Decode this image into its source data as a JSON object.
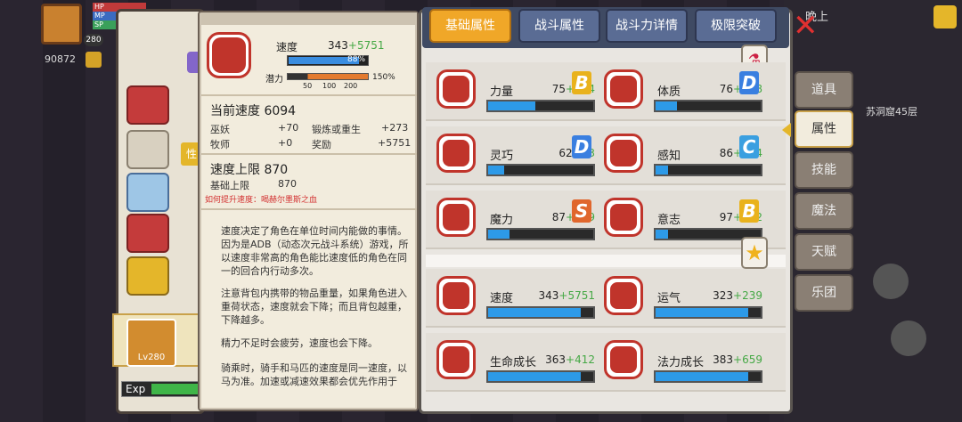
{
  "hud": {
    "level": "280",
    "hp_label": "HP",
    "mp_label": "MP",
    "sp_label": "SP",
    "gold": "90872",
    "night_label": "晚上",
    "dungeon_label": "苏洞窟45层",
    "exp_label": "Exp",
    "char_level": "Lv280"
  },
  "equip_tab_label": "性",
  "tooltip": {
    "speed_label": "速度",
    "speed_base": "343",
    "speed_bonus": "+5751",
    "bar_percent": "88%",
    "potential_label": "潜力",
    "potential_scale": [
      "50",
      "100",
      "200"
    ],
    "potential_percent": "150%",
    "current_speed_label": "当前速度",
    "current_speed_value": "6094",
    "sources": [
      {
        "name": "巫妖",
        "value": "+70",
        "name2": "锻炼或重生",
        "value2": "+273"
      },
      {
        "name": "牧师",
        "value": "+0",
        "name2": "奖励",
        "value2": "+5751"
      }
    ],
    "cap_label": "速度上限",
    "cap_value": "870",
    "base_cap_label": "基础上限",
    "base_cap_value": "870",
    "how_to_raise": "如何提升速度：",
    "how_to_raise_link": "喝赫尔墨斯之血",
    "para1": "速度决定了角色在单位时间内能做的事情。因为是ADB（动态次元战斗系统）游戏，所以速度非常高的角色能比速度低的角色在同一的回合内行动多次。",
    "para2": "注意背包内携带的物品重量，如果角色进入重荷状态，速度就会下降；而且背包越重，下降越多。",
    "para3": "精力不足时会疲劳，速度也会下降。",
    "para4": "骑乘时，骑手和马匹的速度是同一速度，以马为准。加速或减速效果都会优先作用于"
  },
  "tabs": [
    {
      "label": "基础属性",
      "active": true
    },
    {
      "label": "战斗属性",
      "active": false
    },
    {
      "label": "战斗力详情",
      "active": false
    },
    {
      "label": "极限突破",
      "active": false
    }
  ],
  "stats": [
    {
      "name": "力量",
      "base": "75",
      "bonus": "+104",
      "grade": "B",
      "fill": 0.45
    },
    {
      "name": "体质",
      "base": "76",
      "bonus": "+318",
      "grade": "D",
      "fill": 0.2
    },
    {
      "name": "灵巧",
      "base": "62",
      "bonus": "+53",
      "grade": "D",
      "fill": 0.15
    },
    {
      "name": "感知",
      "base": "86",
      "bonus": "+134",
      "grade": "C",
      "fill": 0.12
    },
    {
      "name": "魔力",
      "base": "87",
      "bonus": "+519",
      "grade": "S",
      "fill": 0.2
    },
    {
      "name": "意志",
      "base": "97",
      "bonus": "+132",
      "grade": "B",
      "fill": 0.12
    },
    {
      "name": "速度",
      "base": "343",
      "bonus": "+5751",
      "grade": "",
      "fill": 0.88
    },
    {
      "name": "运气",
      "base": "323",
      "bonus": "+239",
      "grade": "",
      "fill": 0.88
    },
    {
      "name": "生命成长",
      "base": "363",
      "bonus": "+412",
      "grade": "",
      "fill": 0.88
    },
    {
      "name": "法力成长",
      "base": "383",
      "bonus": "+659",
      "grade": "",
      "fill": 0.88
    }
  ],
  "side_menu": [
    {
      "label": "道具",
      "active": false
    },
    {
      "label": "属性",
      "active": true
    },
    {
      "label": "技能",
      "active": false
    },
    {
      "label": "魔法",
      "active": false
    },
    {
      "label": "天赋",
      "active": false
    },
    {
      "label": "乐团",
      "active": false
    }
  ],
  "colors": {
    "accent_red": "#c0342b",
    "tab_active": "#f0a728",
    "bar_blue": "#2d9ae8",
    "bonus_green": "#45a845"
  }
}
